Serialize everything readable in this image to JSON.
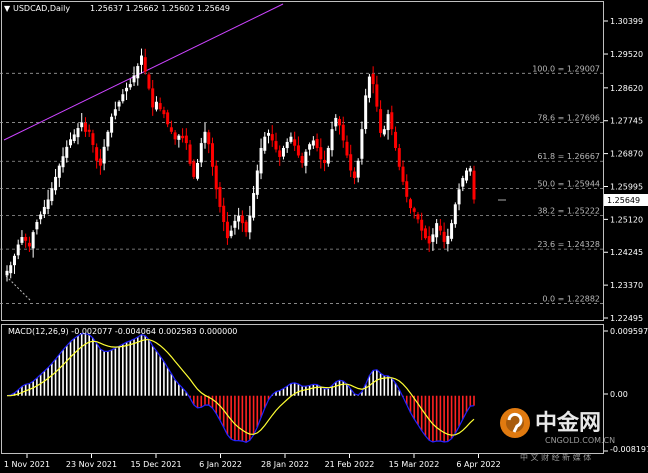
{
  "chart_header": {
    "symbol_label": "USDCAD,Daily",
    "ohlc": "1.25637 1.25662 1.25602 1.25649"
  },
  "price_axis": {
    "ticks": [
      "1.30399",
      "1.29520",
      "1.28620",
      "1.27745",
      "1.26870",
      "1.25995",
      "1.25120",
      "1.24245",
      "1.23370",
      "1.22495"
    ],
    "current_price": "1.25649"
  },
  "macd": {
    "label": "MACD(12,26,9) -0.002077 -0.004064 0.002583 0.000000",
    "axis_top": "0.009597",
    "axis_mid": "0.00",
    "axis_low": "-0.008197"
  },
  "fibonacci": {
    "levels": [
      {
        "label": "100.0 = 1.29007",
        "price": 1.29007
      },
      {
        "label": "78.6 = 1.27696",
        "price": 1.27696
      },
      {
        "label": "61.8 = 1.26667",
        "price": 1.26667
      },
      {
        "label": "50.0 = 1.25944",
        "price": 1.25944
      },
      {
        "label": "38.2 = 1.25222",
        "price": 1.25222
      },
      {
        "label": "23.6 = 1.24328",
        "price": 1.24328
      },
      {
        "label": "0.0 = 1.22882",
        "price": 1.22882
      }
    ]
  },
  "time_axis": {
    "ticks": [
      "1 Nov 2021",
      "23 Nov 2021",
      "15 Dec 2021",
      "6 Jan 2022",
      "28 Jan 2022",
      "21 Feb 2022",
      "15 Mar 2022",
      "6 Apr 2022"
    ]
  },
  "watermark": {
    "brand": "中金网",
    "site": "CNGOLD.COM.CN",
    "tagline": "中 文 财 经 新 媒 体"
  },
  "colors": {
    "bull": "#ffffff",
    "bear": "#ff0000",
    "trendline": "#cc44ff",
    "macd_line": "#2222ff",
    "signal_line": "#ffff33"
  },
  "chart_data": {
    "type": "candlestick",
    "title": "USDCAD,Daily",
    "close_path": [
      1.2375,
      1.239,
      1.2415,
      1.2445,
      1.2465,
      1.2455,
      1.244,
      1.2478,
      1.2505,
      1.2525,
      1.2545,
      1.2565,
      1.2595,
      1.2625,
      1.2655,
      1.268,
      1.2705,
      1.2725,
      1.2738,
      1.2755,
      1.277,
      1.2745,
      1.2745,
      1.271,
      1.2668,
      1.2655,
      1.2705,
      1.2745,
      1.2785,
      1.2805,
      1.2825,
      1.2845,
      1.2862,
      1.2872,
      1.2895,
      1.292,
      1.2948,
      1.2905,
      1.286,
      1.281,
      1.2825,
      1.2805,
      1.2792,
      1.2765,
      1.2745,
      1.2725,
      1.2735,
      1.2728,
      1.2715,
      1.266,
      1.2625,
      1.2662,
      1.2715,
      1.2745,
      1.2712,
      1.2652,
      1.2592,
      1.2545,
      1.2505,
      1.2462,
      1.2482,
      1.2508,
      1.2522,
      1.2502,
      1.2478,
      1.2522,
      1.2582,
      1.2642,
      1.2702,
      1.2732,
      1.2742,
      1.2722,
      1.2698,
      1.2678,
      1.2702,
      1.2718,
      1.2732,
      1.2708,
      1.2682,
      1.2662,
      1.2692,
      1.2712,
      1.2722,
      1.2702,
      1.2672,
      1.2662,
      1.2702,
      1.2752,
      1.2782,
      1.2762,
      1.2722,
      1.2682,
      1.2642,
      1.2622,
      1.2668,
      1.2752,
      1.2842,
      1.2892,
      1.2872,
      1.2812,
      1.2742,
      1.2752,
      1.2792,
      1.2752,
      1.2702,
      1.2652,
      1.2612,
      1.2572,
      1.2542,
      1.2532,
      1.2512,
      1.2482,
      1.2462,
      1.2448,
      1.2472,
      1.2502,
      1.2482,
      1.2452,
      1.2468,
      1.2502,
      1.2552,
      1.2592,
      1.2622,
      1.2642,
      1.2648,
      1.25649
    ]
  }
}
